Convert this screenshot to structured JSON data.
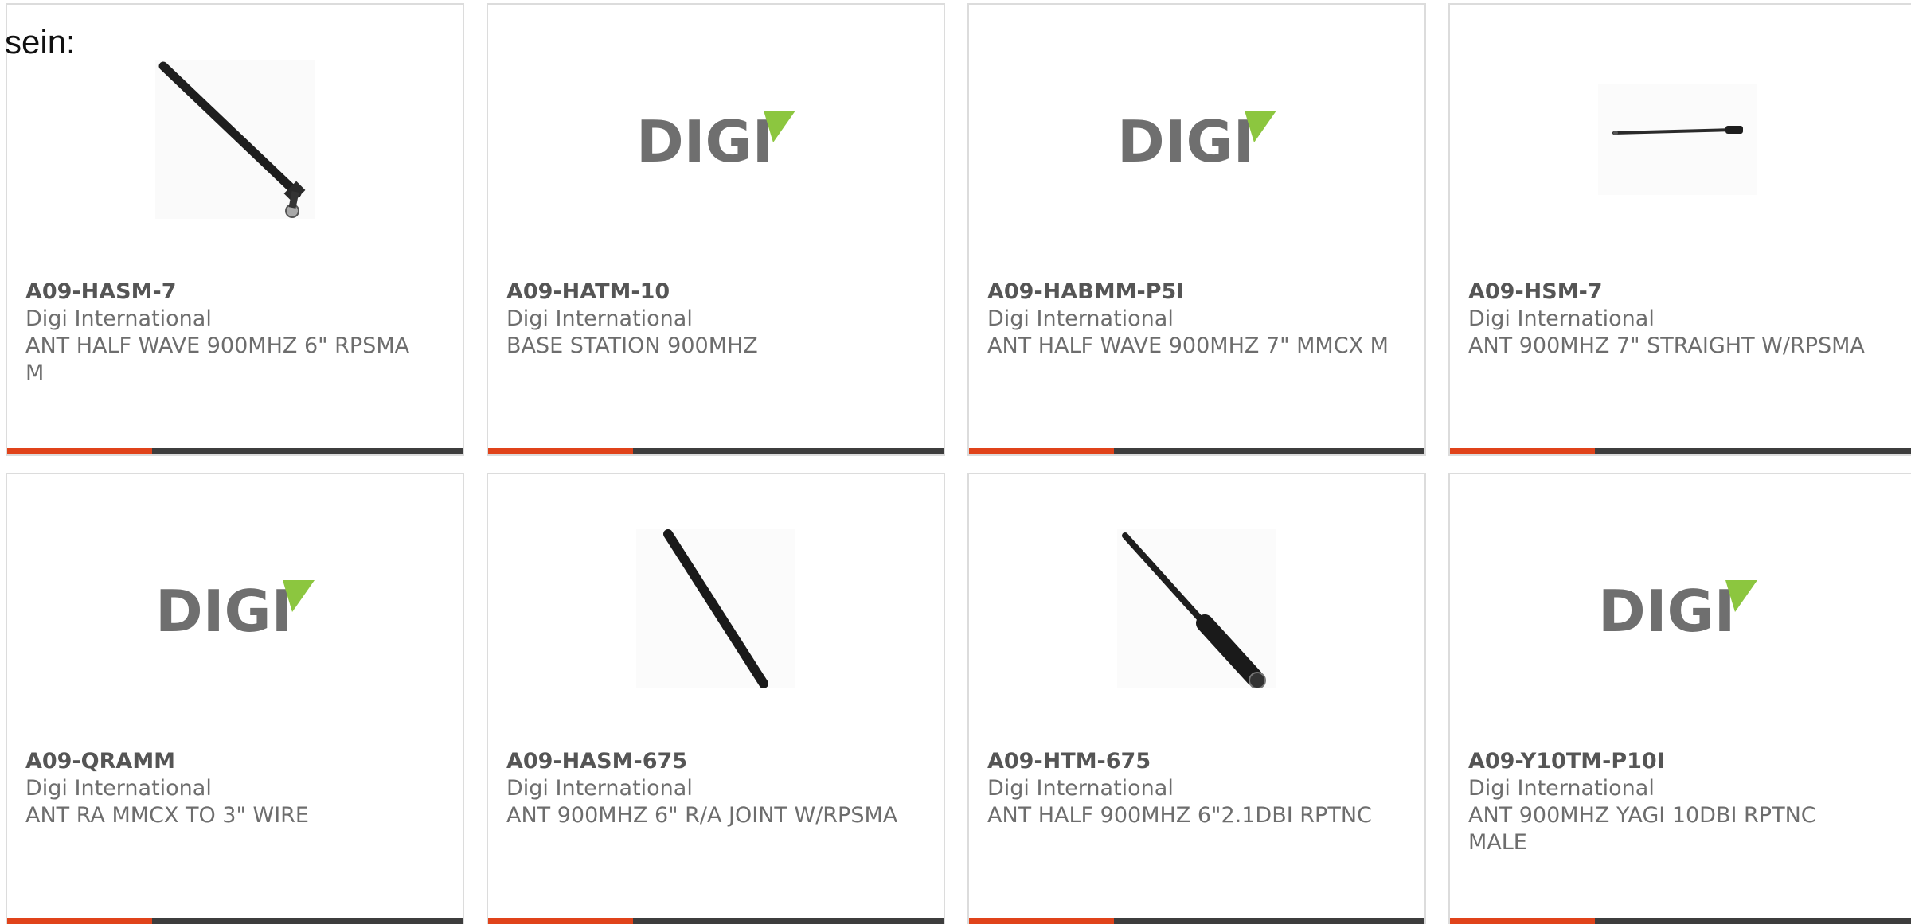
{
  "intro_text": "sein:",
  "colors": {
    "accent": "#e0431a",
    "bar": "#3d3d3d",
    "digi_logo_gray": "#6f6f6f",
    "digi_logo_green": "#8cc63f",
    "card_border": "#dcdcdc"
  },
  "products": [
    {
      "part": "A09-HASM-7",
      "manufacturer": "Digi International",
      "description": "ANT HALF WAVE 900MHZ 6\" RPSMA M",
      "image": "antenna-right-angle-icon"
    },
    {
      "part": "A09-HATM-10",
      "manufacturer": "Digi International",
      "description": "BASE STATION 900MHZ",
      "image": "digi-logo"
    },
    {
      "part": "A09-HABMM-P5I",
      "manufacturer": "Digi International",
      "description": "ANT HALF WAVE 900MHZ 7\" MMCX M",
      "image": "digi-logo"
    },
    {
      "part": "A09-HSM-7",
      "manufacturer": "Digi International",
      "description": "ANT 900MHZ 7\" STRAIGHT W/RPSMA",
      "image": "antenna-straight-icon"
    },
    {
      "part": "A09-QRAMM",
      "manufacturer": "Digi International",
      "description": "ANT RA MMCX TO 3\" WIRE",
      "image": "digi-logo"
    },
    {
      "part": "A09-HASM-675",
      "manufacturer": "Digi International",
      "description": "ANT 900MHZ 6\" R/A JOINT W/RPSMA",
      "image": "antenna-diagonal-icon"
    },
    {
      "part": "A09-HTM-675",
      "manufacturer": "Digi International",
      "description": "ANT HALF 900MHZ 6\"2.1DBI RPTNC",
      "image": "antenna-tnc-icon"
    },
    {
      "part": "A09-Y10TM-P10I",
      "manufacturer": "Digi International",
      "description": "ANT 900MHZ YAGI 10DBI RPTNC MALE",
      "image": "digi-logo"
    }
  ],
  "logo": {
    "text": "DIGI"
  }
}
